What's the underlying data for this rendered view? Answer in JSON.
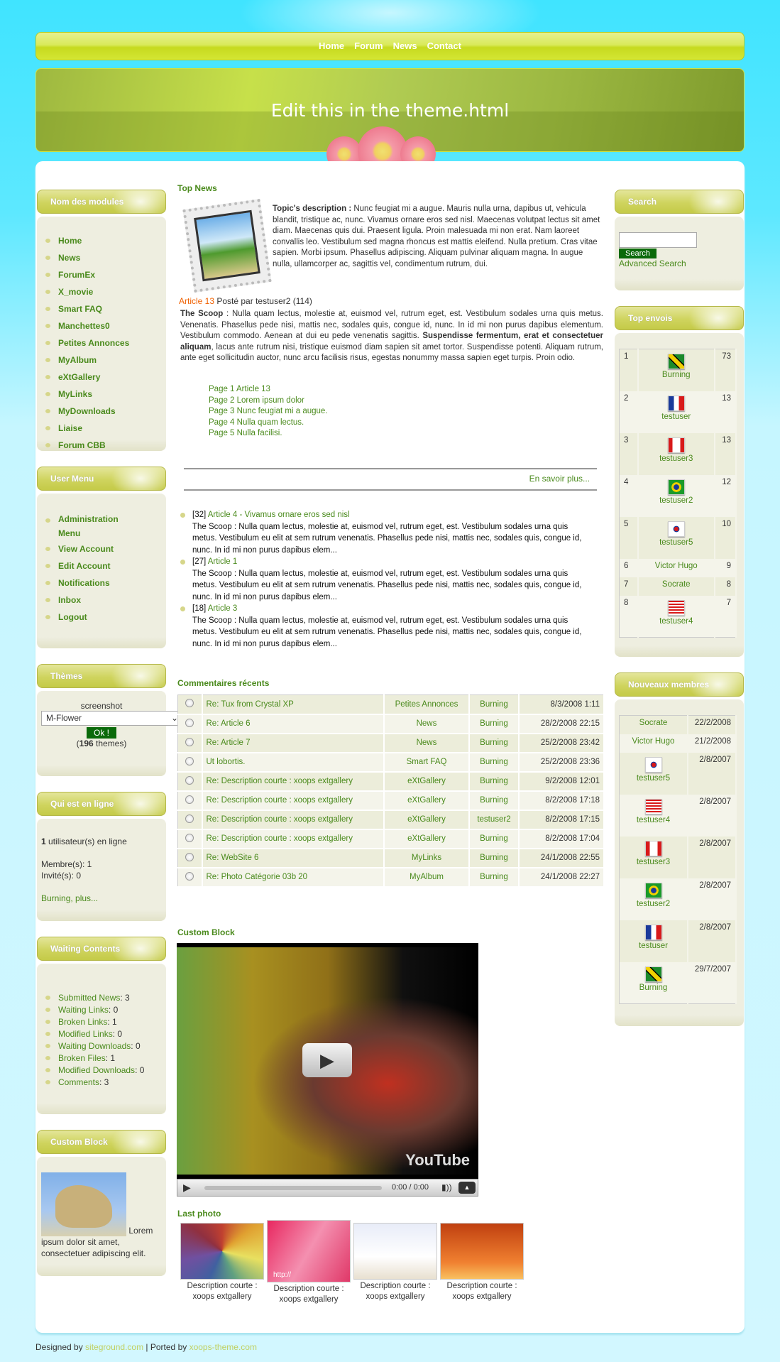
{
  "nav": [
    "Home",
    "Forum",
    "News",
    "Contact"
  ],
  "banner_title": "Edit this in the theme.html",
  "left": {
    "modules": {
      "title": "Nom des modules",
      "items": [
        "Home",
        "News",
        "ForumEx",
        "X_movie",
        "Smart FAQ",
        "Manchettes0",
        "Petites Annonces",
        "MyAlbum",
        "eXtGallery",
        "MyLinks",
        "MyDownloads",
        "Liaise",
        "Forum CBB"
      ]
    },
    "user_menu": {
      "title": "User Menu",
      "items": [
        "Administration Menu",
        "View Account",
        "Edit Account",
        "Notifications",
        "Inbox",
        "Logout"
      ]
    },
    "themes": {
      "title": "Thèmes",
      "label": "screenshot",
      "selected": "M-Flower",
      "ok": "Ok !",
      "count_prefix": "(",
      "count": "196",
      "count_suffix": " themes)"
    },
    "online": {
      "title": "Qui est en ligne",
      "count": "1",
      "count_text": " utilisateur(s) en ligne",
      "members": "Membre(s): 1",
      "guests": "Invité(s): 0",
      "link": "Burning, plus..."
    },
    "waiting": {
      "title": "Waiting Contents",
      "items": [
        {
          "label": "Submitted News",
          "value": ": 3"
        },
        {
          "label": "Waiting Links",
          "value": ": 0"
        },
        {
          "label": "Broken Links",
          "value": ": 1"
        },
        {
          "label": "Modified Links",
          "value": ": 0"
        },
        {
          "label": "Waiting Downloads",
          "value": ": 0"
        },
        {
          "label": "Broken Files",
          "value": ": 1"
        },
        {
          "label": "Modified Downloads",
          "value": ": 0"
        },
        {
          "label": "Comments",
          "value": ": 3"
        }
      ]
    },
    "custom": {
      "title": "Custom Block",
      "text": "Lorem ipsum dolor sit amet, consectetuer adipiscing elit."
    }
  },
  "center": {
    "top_news": "Top News",
    "desc_label": "Topic's description :",
    "desc": " Nunc feugiat mi a augue. Mauris nulla urna, dapibus ut, vehicula blandit, tristique ac, nunc. Vivamus ornare eros sed nisl. Maecenas volutpat lectus sit amet diam. Maecenas quis dui. Praesent ligula. Proin malesuada mi non erat. Nam laoreet convallis leo. Vestibulum sed magna rhoncus est mattis eleifend. Nulla pretium. Cras vitae sapien. Morbi ipsum. Phasellus adipiscing. Aliquam pulvinar aliquam magna. In augue nulla, ullamcorper ac, sagittis vel, condimentum rutrum, dui.",
    "article_title": "Article 13",
    "article_meta": " Posté par testuser2 (114)",
    "scoop_label": "The Scoop",
    "scoop1": " : Nulla quam lectus, molestie at, euismod vel, rutrum eget, est. Vestibulum sodales urna quis metus. Venenatis. Phasellus pede nisi, mattis nec, sodales quis, congue id, nunc. In id mi non purus dapibus elementum. Vestibulum commodo. Aenean at dui eu pede venenatis sagittis. ",
    "scoop_bold": "Suspendisse fermentum, erat et consectetuer aliquam",
    "scoop2": ", lacus ante rutrum nisi, tristique euismod diam sapien sit amet tortor. Suspendisse potenti. Aliquam rutrum, ante eget sollicitudin auctor, nunc arcu facilisis risus, egestas nonummy massa sapien eget turpis. Proin odio.",
    "pages": [
      "Page 1 Article 13",
      "Page 2 Lorem ipsum dolor",
      "Page 3 Nunc feugiat mi a augue.",
      "Page 4 Nulla quam lectus.",
      "Page 5 Nulla facilisi."
    ],
    "more": "En savoir plus...",
    "news": [
      {
        "count": "[32] ",
        "title": "Article 4 - Vivamus ornare eros sed nisl",
        "text": "The Scoop : Nulla quam lectus, molestie at, euismod vel, rutrum eget, est. Vestibulum sodales urna quis metus. Vestibulum eu elit at sem rutrum venenatis. Phasellus pede nisi, mattis nec, sodales quis, congue id, nunc. In id mi non purus dapibus elem..."
      },
      {
        "count": "[27] ",
        "title": "Article 1",
        "text": "The Scoop : Nulla quam lectus, molestie at, euismod vel, rutrum eget, est. Vestibulum sodales urna quis metus. Vestibulum eu elit at sem rutrum venenatis. Phasellus pede nisi, mattis nec, sodales quis, congue id, nunc. In id mi non purus dapibus elem..."
      },
      {
        "count": "[18] ",
        "title": "Article 3",
        "text": "The Scoop : Nulla quam lectus, molestie at, euismod vel, rutrum eget, est. Vestibulum sodales urna quis metus. Vestibulum eu elit at sem rutrum venenatis. Phasellus pede nisi, mattis nec, sodales quis, congue id, nunc. In id mi non purus dapibus elem..."
      }
    ],
    "comments_title": "Commentaires récents",
    "comments": [
      [
        "Re: Tux from Crystal XP",
        "Petites Annonces",
        "Burning",
        "8/3/2008 1:11"
      ],
      [
        "Re: Article 6",
        "News",
        "Burning",
        "28/2/2008 22:15"
      ],
      [
        "Re: Article 7",
        "News",
        "Burning",
        "25/2/2008 23:42"
      ],
      [
        "Ut lobortis.",
        "Smart FAQ",
        "Burning",
        "25/2/2008 23:36"
      ],
      [
        "Re: Description courte : xoops extgallery",
        "eXtGallery",
        "Burning",
        "9/2/2008 12:01"
      ],
      [
        "Re: Description courte : xoops extgallery",
        "eXtGallery",
        "Burning",
        "8/2/2008 17:18"
      ],
      [
        "Re: Description courte : xoops extgallery",
        "eXtGallery",
        "testuser2",
        "8/2/2008 17:15"
      ],
      [
        "Re: Description courte : xoops extgallery",
        "eXtGallery",
        "Burning",
        "8/2/2008 17:04"
      ],
      [
        "Re: WebSite 6",
        "MyLinks",
        "Burning",
        "24/1/2008 22:55"
      ],
      [
        "Re: Photo Catégorie 03b 20",
        "MyAlbum",
        "Burning",
        "24/1/2008 22:27"
      ]
    ],
    "custom_title": "Custom Block",
    "video": {
      "logo": "YouTube",
      "time": "0:00 / 0:00"
    },
    "photo_title": "Last photo",
    "photos": [
      "Description courte : xoops extgallery",
      "Description courte : xoops extgallery",
      "Description courte : xoops extgallery",
      "Description courte : xoops extgallery"
    ],
    "photo_http": "http://"
  },
  "right": {
    "search": {
      "title": "Search",
      "value": "",
      "button": "Search",
      "advanced": "Advanced Search"
    },
    "top": {
      "title": "Top envois",
      "rows": [
        {
          "rank": "1",
          "name": "Burning",
          "flag": "jm",
          "count": "73"
        },
        {
          "rank": "2",
          "name": "testuser",
          "flag": "fr",
          "count": "13"
        },
        {
          "rank": "3",
          "name": "testuser3",
          "flag": "ca",
          "count": "13"
        },
        {
          "rank": "4",
          "name": "testuser2",
          "flag": "br",
          "count": "12"
        },
        {
          "rank": "5",
          "name": "testuser5",
          "flag": "kr",
          "count": "10"
        },
        {
          "rank": "6",
          "name": "Victor Hugo",
          "flag": "",
          "count": "9"
        },
        {
          "rank": "7",
          "name": "Socrate",
          "flag": "",
          "count": "8"
        },
        {
          "rank": "8",
          "name": "testuser4",
          "flag": "us",
          "count": "7"
        }
      ]
    },
    "new": {
      "title": "Nouveaux membres",
      "rows": [
        {
          "name": "Socrate",
          "flag": "",
          "date": "22/2/2008"
        },
        {
          "name": "Victor Hugo",
          "flag": "",
          "date": "21/2/2008"
        },
        {
          "name": "testuser5",
          "flag": "kr",
          "date": "2/8/2007"
        },
        {
          "name": "testuser4",
          "flag": "us",
          "date": "2/8/2007"
        },
        {
          "name": "testuser3",
          "flag": "ca",
          "date": "2/8/2007"
        },
        {
          "name": "testuser2",
          "flag": "br",
          "date": "2/8/2007"
        },
        {
          "name": "testuser",
          "flag": "fr",
          "date": "2/8/2007"
        },
        {
          "name": "Burning",
          "flag": "jm",
          "date": "29/7/2007"
        }
      ]
    }
  },
  "footer": {
    "designed": "Designed by ",
    "site1": "siteground.com",
    "sep": " | Ported by ",
    "site2": "xoops-theme.com"
  }
}
